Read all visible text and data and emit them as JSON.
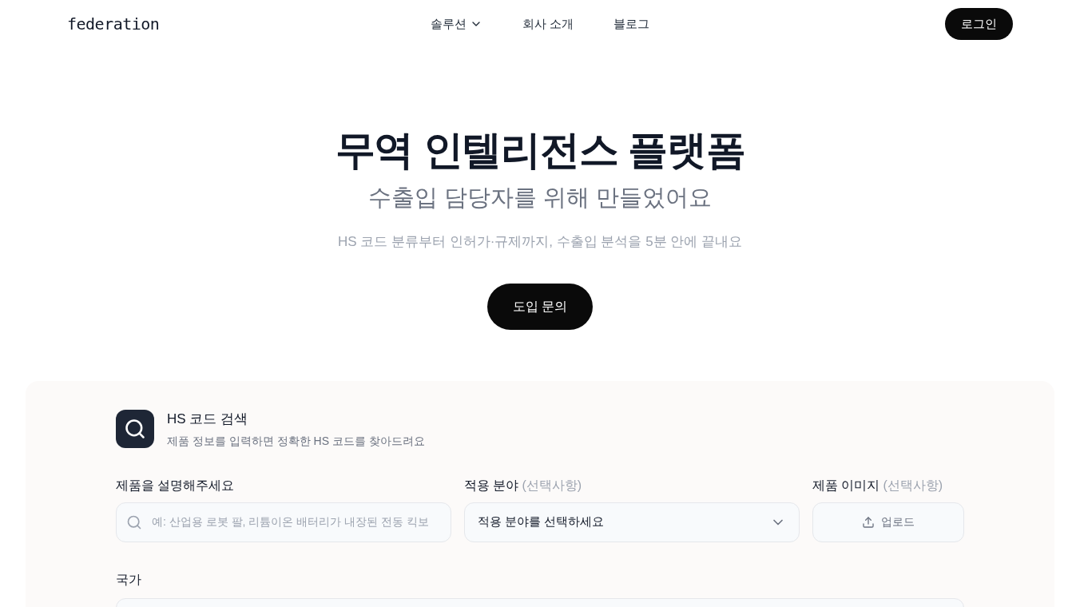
{
  "header": {
    "logo": "federation",
    "nav": [
      {
        "label": "솔루션",
        "kind": "dropdown"
      },
      {
        "label": "회사 소개",
        "kind": "link"
      },
      {
        "label": "블로그",
        "kind": "link"
      }
    ],
    "login": "로그인"
  },
  "hero": {
    "title": "무역 인텔리전스 플랫폼",
    "subtitle": "수출입 담당자를 위해 만들었어요",
    "description": "HS 코드 분류부터 인허가·규제까지, 수출입 분석을 5분 안에 끝내요",
    "cta": "도입 문의"
  },
  "search_card": {
    "title": "HS 코드 검색",
    "description": "제품 정보를 입력하면 정확한 HS 코드를 찾아드려요",
    "fields": [
      {
        "kind": "text",
        "label": "제품을 설명해주세요",
        "placeholder": "예: 산업용 로봇 팔, 리튬이온 배터리가 내장된 전동 킥보"
      },
      {
        "kind": "select",
        "label": "적용 분야",
        "optional": "(선택사항)",
        "value": "적용 분야를 선택하세요"
      },
      {
        "kind": "upload",
        "label": "제품 이미지",
        "optional": "(선택사항)",
        "value": "업로드"
      }
    ],
    "country_label": "국가"
  }
}
